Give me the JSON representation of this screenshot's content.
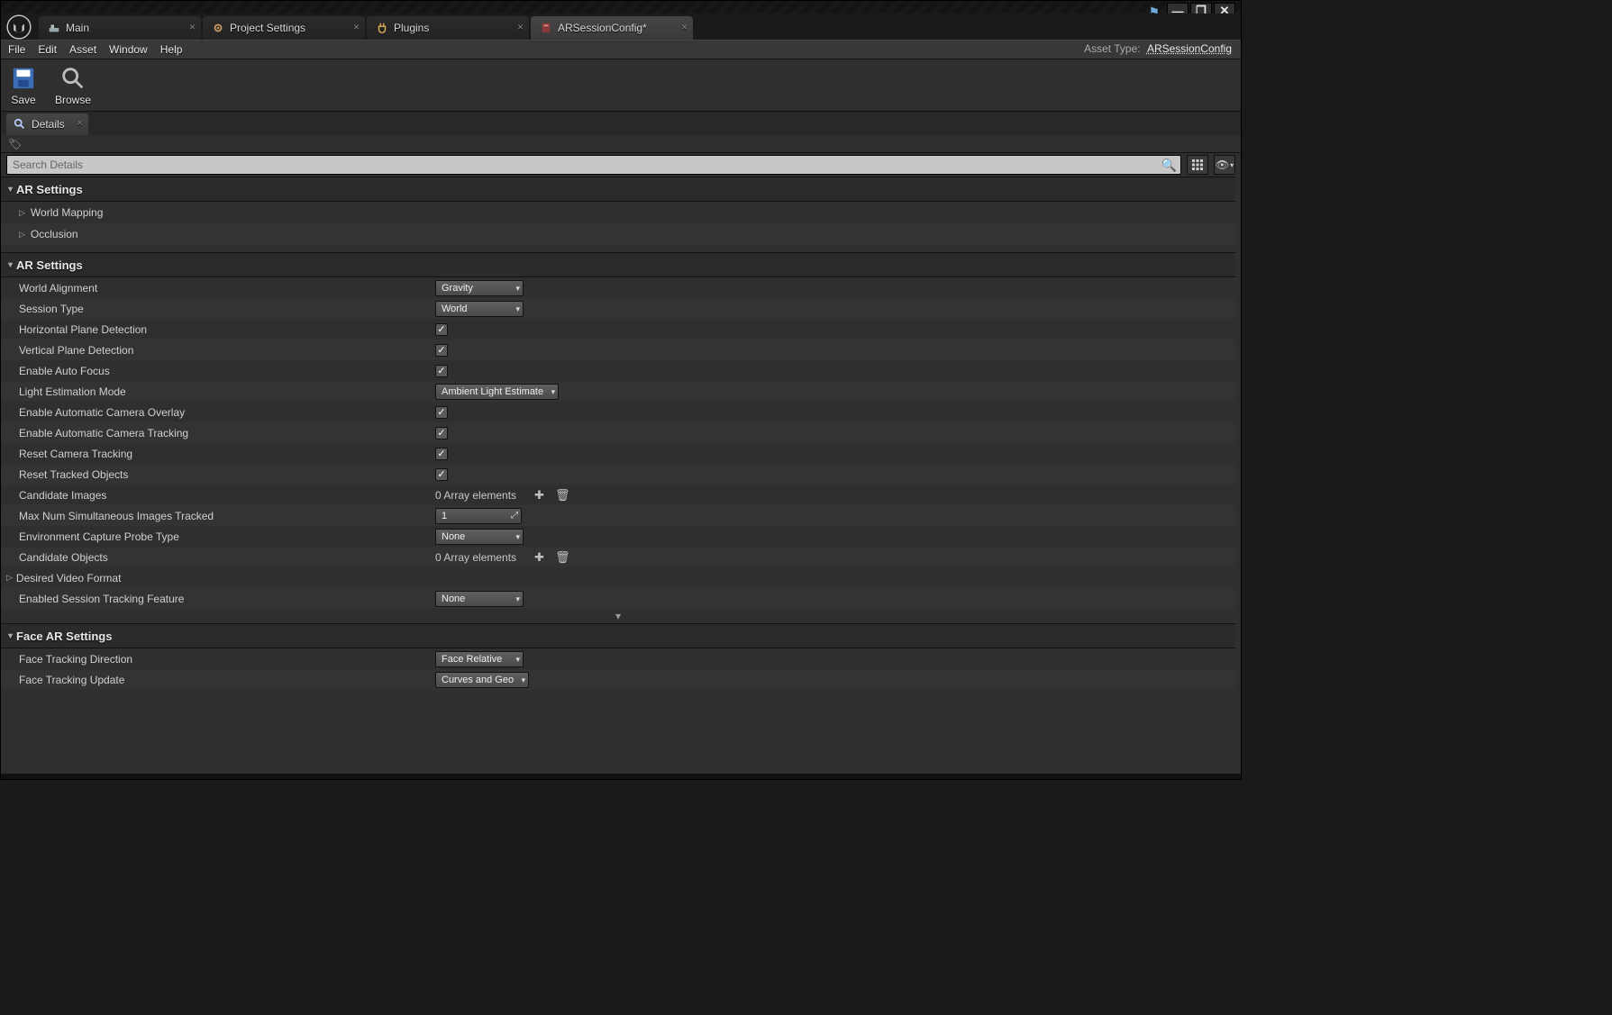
{
  "window_controls": {
    "min": "—",
    "max": "❐",
    "close": "✕"
  },
  "tabs": [
    {
      "label": "Main",
      "active": false,
      "icon": "level"
    },
    {
      "label": "Project Settings",
      "active": false,
      "icon": "gear"
    },
    {
      "label": "Plugins",
      "active": false,
      "icon": "plug"
    },
    {
      "label": "ARSessionConfig*",
      "active": true,
      "icon": "datasset"
    }
  ],
  "menus": [
    "File",
    "Edit",
    "Asset",
    "Window",
    "Help"
  ],
  "asset_type": {
    "label": "Asset Type:",
    "value": "ARSessionConfig"
  },
  "toolbar": {
    "save": "Save",
    "browse": "Browse"
  },
  "panel_tab": "Details",
  "search": {
    "placeholder": "Search Details"
  },
  "cat1": {
    "title": "AR Settings",
    "sub1": "World Mapping",
    "sub2": "Occlusion"
  },
  "cat2": {
    "title": "AR Settings",
    "rows": {
      "world_alignment": {
        "label": "World Alignment",
        "value": "Gravity"
      },
      "session_type": {
        "label": "Session Type",
        "value": "World"
      },
      "horiz_plane": {
        "label": "Horizontal Plane Detection",
        "checked": true
      },
      "vert_plane": {
        "label": "Vertical Plane Detection",
        "checked": true
      },
      "auto_focus": {
        "label": "Enable Auto Focus",
        "checked": true
      },
      "light_est": {
        "label": "Light Estimation Mode",
        "value": "Ambient Light Estimate"
      },
      "cam_overlay": {
        "label": "Enable Automatic Camera Overlay",
        "checked": true
      },
      "cam_track": {
        "label": "Enable Automatic Camera Tracking",
        "checked": true
      },
      "reset_cam": {
        "label": "Reset Camera Tracking",
        "checked": true
      },
      "reset_obj": {
        "label": "Reset Tracked Objects",
        "checked": true
      },
      "cand_images": {
        "label": "Candidate Images",
        "value": "0 Array elements"
      },
      "max_num": {
        "label": "Max Num Simultaneous Images Tracked",
        "value": "1"
      },
      "env_probe": {
        "label": "Environment Capture Probe Type",
        "value": "None"
      },
      "cand_obj": {
        "label": "Candidate Objects",
        "value": "0 Array elements"
      },
      "video_fmt": {
        "label": "Desired Video Format"
      },
      "sess_feat": {
        "label": "Enabled Session Tracking Feature",
        "value": "None"
      }
    }
  },
  "cat3": {
    "title": "Face AR Settings",
    "rows": {
      "face_dir": {
        "label": "Face Tracking Direction",
        "value": "Face Relative"
      },
      "face_upd": {
        "label": "Face Tracking Update",
        "value": "Curves and Geo"
      }
    }
  }
}
